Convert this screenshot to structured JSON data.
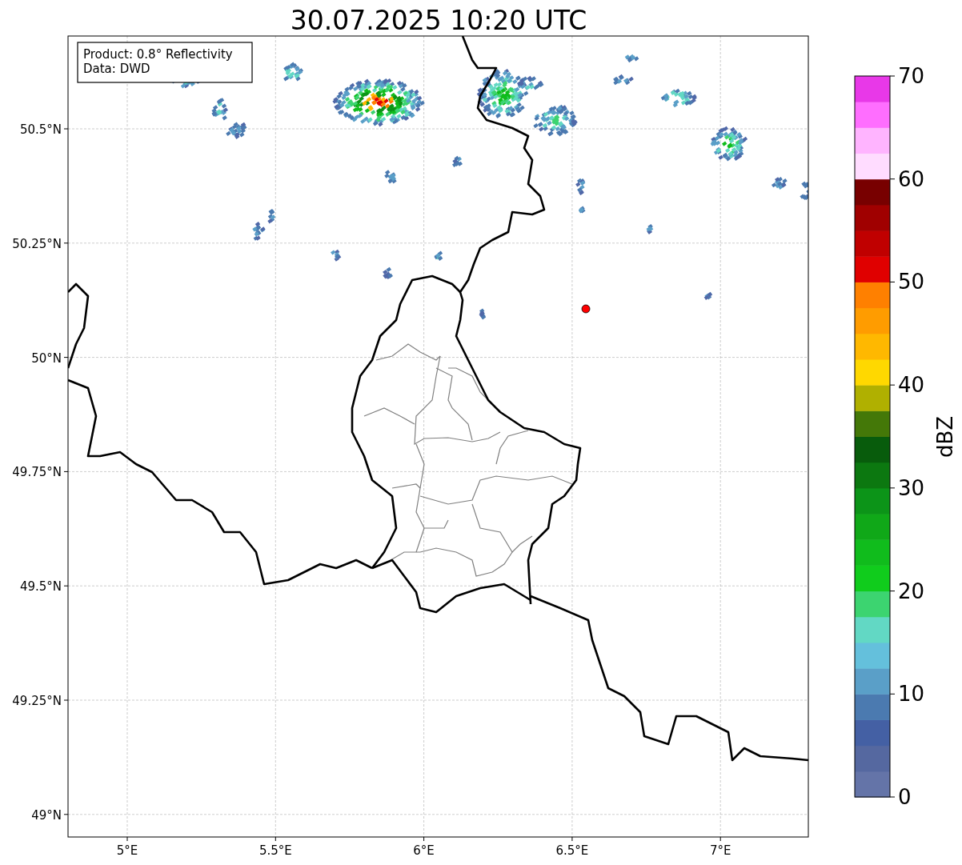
{
  "title": "30.07.2025 10:20 UTC",
  "legend": [
    "Product: 0.8° Reflectivity",
    "Data: DWD"
  ],
  "y_ticks": [
    "50.5°N",
    "50.25°N",
    "50°N",
    "49.75°N",
    "49.5°N",
    "49.25°N",
    "49°N"
  ],
  "x_ticks": [
    "5°E",
    "5.5°E",
    "6°E",
    "6.5°E",
    "7°E"
  ],
  "colorbar": {
    "label": "dBZ",
    "ticks": [
      "70",
      "60",
      "50",
      "40",
      "30",
      "20",
      "10",
      "0"
    ],
    "colors": [
      {
        "color": "#6474a8"
      },
      {
        "color": "#5568a0"
      },
      {
        "color": "#4460a4"
      },
      {
        "color": "#4b7ab0"
      },
      {
        "color": "#5a9fc8"
      },
      {
        "color": "#64c0dc"
      },
      {
        "color": "#62d8c4"
      },
      {
        "color": "#3cd470"
      },
      {
        "color": "#10cc1c"
      },
      {
        "color": "#10bc1c"
      },
      {
        "color": "#10a818"
      },
      {
        "color": "#0c9418"
      },
      {
        "color": "#0c7810"
      },
      {
        "color": "#085c0c"
      },
      {
        "color": "#447808"
      },
      {
        "color": "#b0b000"
      },
      {
        "color": "#ffd800"
      },
      {
        "color": "#ffb800"
      },
      {
        "color": "#ff9c00"
      },
      {
        "color": "#ff8000"
      },
      {
        "color": "#e00000"
      },
      {
        "color": "#c00000"
      },
      {
        "color": "#a00000"
      },
      {
        "color": "#780000"
      },
      {
        "color": "#ffdcff"
      },
      {
        "color": "#ffb4ff"
      },
      {
        "color": "#ff6eff"
      },
      {
        "color": "#e838e8"
      }
    ]
  }
}
